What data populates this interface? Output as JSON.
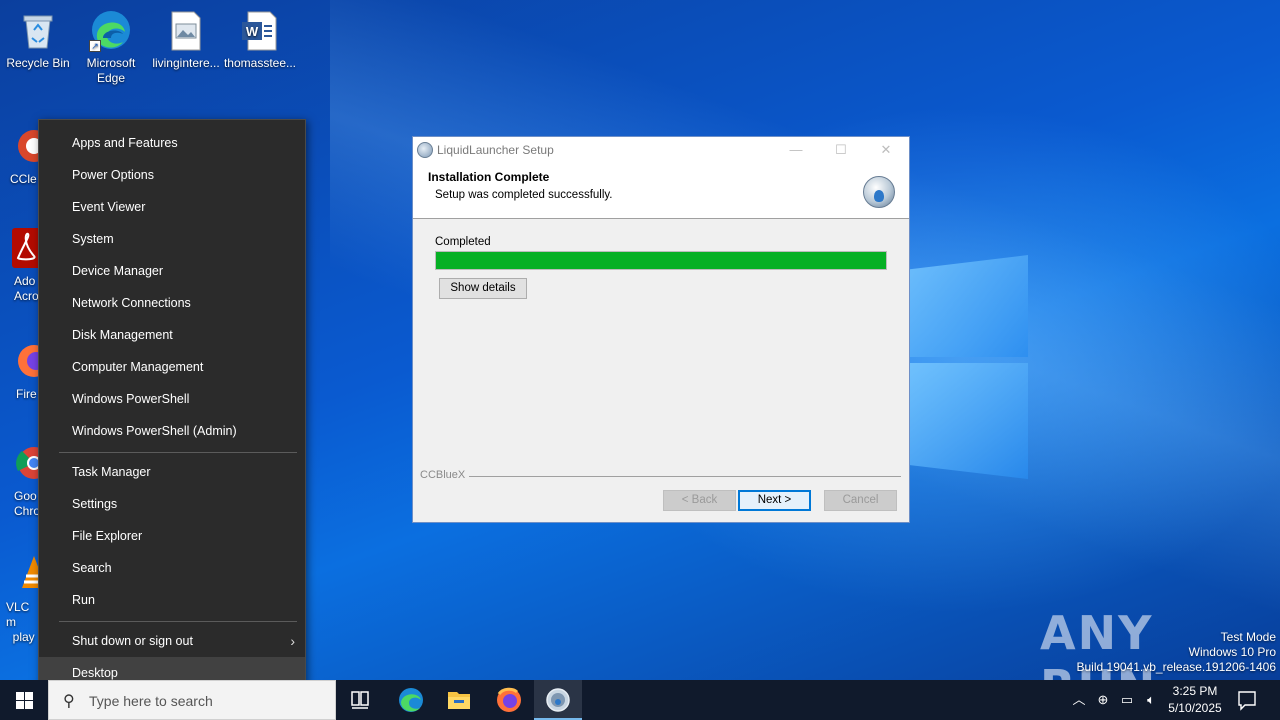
{
  "desktop": {
    "icons": [
      {
        "label": "Recycle Bin",
        "icon": "recycle-bin-icon"
      },
      {
        "label": "Microsoft Edge",
        "icon": "edge-icon"
      },
      {
        "label": "livingintere...",
        "icon": "image-file-icon"
      },
      {
        "label": "thomasstee...",
        "icon": "word-document-icon"
      },
      {
        "label": "CCle",
        "icon": "ccleaner-icon"
      },
      {
        "label": "Ado Acro",
        "icon": "acrobat-icon"
      },
      {
        "label": "Fire",
        "icon": "firefox-icon"
      },
      {
        "label": "Goo Chro",
        "icon": "chrome-icon"
      },
      {
        "label": "VLC m play",
        "icon": "vlc-icon"
      }
    ]
  },
  "winx_menu": {
    "items": [
      {
        "label": "Apps and Features"
      },
      {
        "label": "Power Options"
      },
      {
        "label": "Event Viewer"
      },
      {
        "label": "System"
      },
      {
        "label": "Device Manager"
      },
      {
        "label": "Network Connections"
      },
      {
        "label": "Disk Management"
      },
      {
        "label": "Computer Management"
      },
      {
        "label": "Windows PowerShell"
      },
      {
        "label": "Windows PowerShell (Admin)"
      },
      {
        "label": "Task Manager"
      },
      {
        "label": "Settings"
      },
      {
        "label": "File Explorer"
      },
      {
        "label": "Search"
      },
      {
        "label": "Run"
      },
      {
        "label": "Shut down or sign out"
      },
      {
        "label": "Desktop"
      }
    ],
    "hovered": "Desktop"
  },
  "dialog": {
    "title": "LiquidLauncher Setup",
    "header_title": "Installation Complete",
    "header_subtitle": "Setup was completed successfully.",
    "progress_label": "Completed",
    "progress_fraction": 1.0,
    "show_details_label": "Show details",
    "branding": "CCBlueX",
    "back_label": "< Back",
    "next_label": "Next >",
    "cancel_label": "Cancel",
    "progress_color": "#06b025"
  },
  "watermark": {
    "brand": "ANY RUN",
    "line1": "Test Mode",
    "line2": "Windows 10 Pro",
    "line3": "Build 19041.vb_release.191206-1406"
  },
  "taskbar": {
    "search_placeholder": "Type here to search",
    "apps": [
      "task-view-icon",
      "edge-icon",
      "file-explorer-icon",
      "firefox-icon",
      "liquidlauncher-icon"
    ],
    "clock_time": "3:25 PM",
    "clock_date": "5/10/2025",
    "accent_color": "#76b9ed"
  }
}
